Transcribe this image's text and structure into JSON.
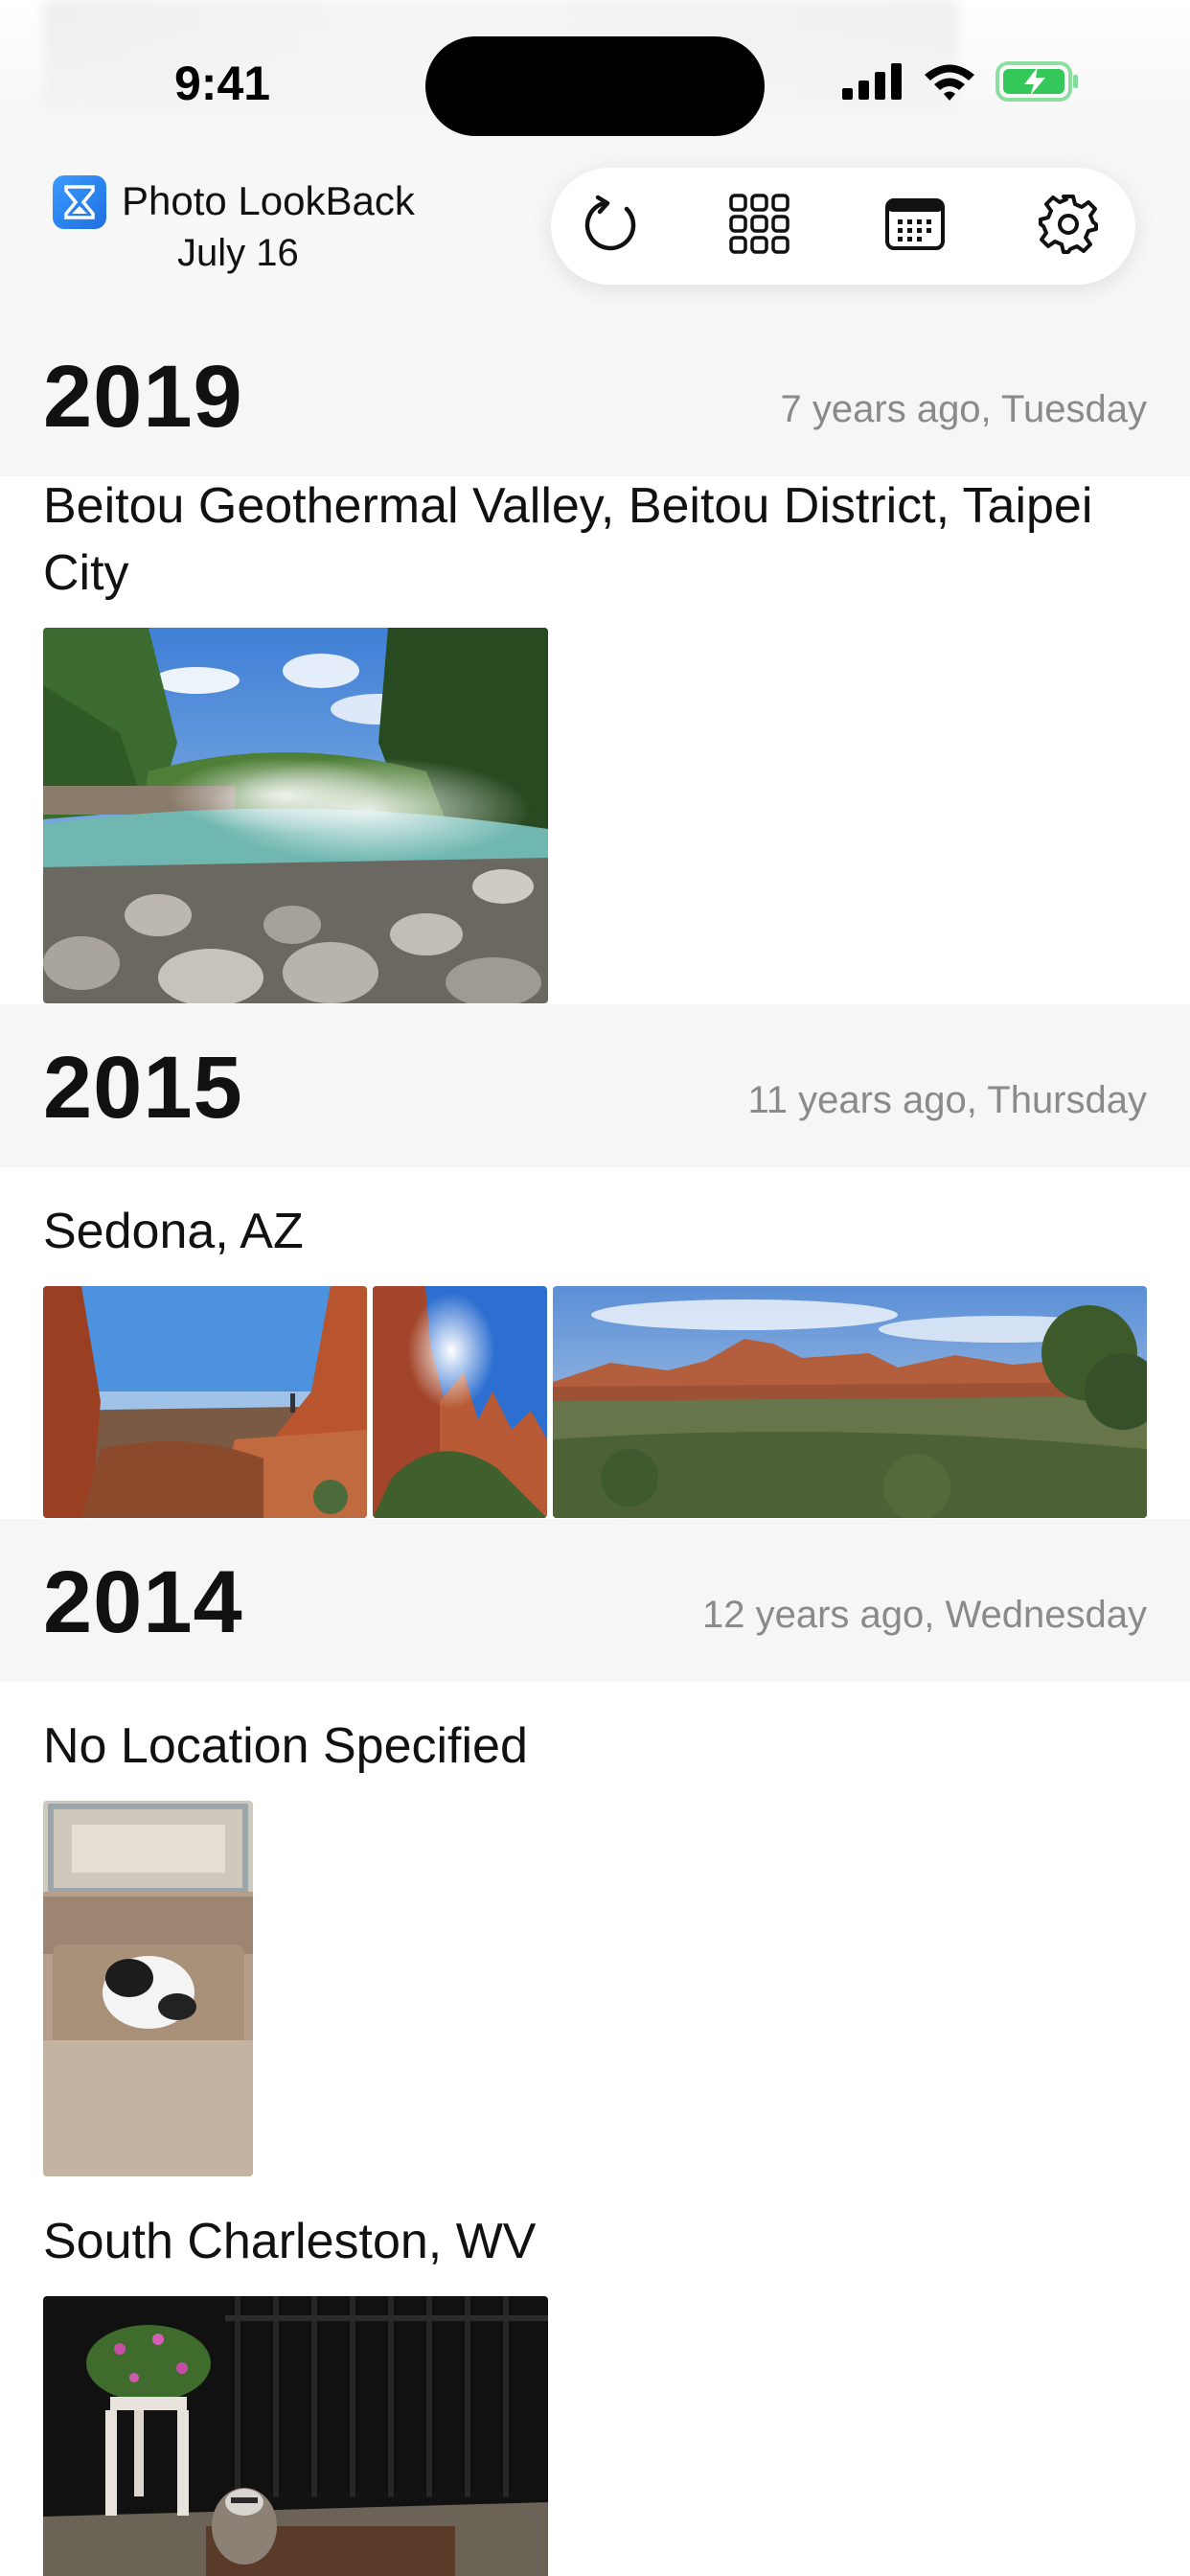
{
  "status_bar": {
    "time": "9:41"
  },
  "header": {
    "app_name": "Photo LookBack",
    "date": "July 16",
    "toolbar": {
      "refresh_icon": "refresh-icon",
      "grid_icon": "grid-icon",
      "calendar_icon": "calendar-icon",
      "settings_icon": "gear-icon"
    }
  },
  "sections": [
    {
      "year": "2019",
      "ago": "7 years ago, Tuesday",
      "locations": [
        {
          "name": "Beitou Geothermal Valley, Beitou District, Taipei City"
        }
      ]
    },
    {
      "year": "2015",
      "ago": "11 years ago, Thursday",
      "locations": [
        {
          "name": "Sedona, AZ"
        }
      ]
    },
    {
      "year": "2014",
      "ago": "12 years ago, Wednesday",
      "locations": [
        {
          "name": "No Location Specified"
        },
        {
          "name": "South Charleston, WV"
        }
      ]
    }
  ],
  "colors": {
    "accent": "#1f6fe0",
    "band": "#f6f6f6",
    "secondary_text": "#8a8a8a",
    "battery": "#34c759"
  }
}
